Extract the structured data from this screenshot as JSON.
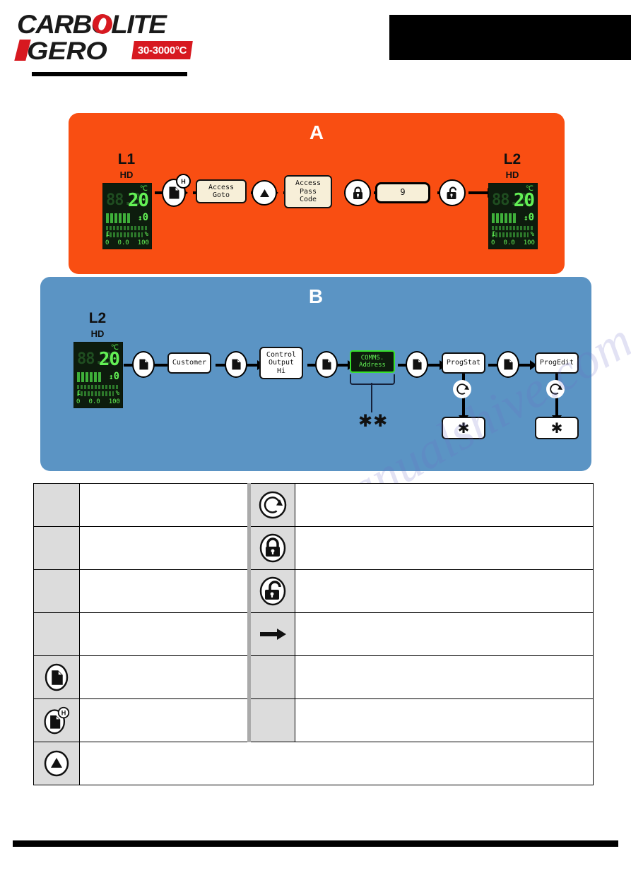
{
  "header": {
    "brand_line1": "CARBOLITE",
    "brand_line2": "GERO",
    "temp_range_badge": "30-3000°C",
    "brand_red": "#d71920",
    "brand_black": "#1a1a1a"
  },
  "panels": {
    "a": {
      "letter": "A",
      "background": "#f94e12",
      "display_start": {
        "level": "L1",
        "mode": "HD",
        "unit": "℃",
        "ghost": "88.8",
        "main": "20",
        "setpoint": "0",
        "tick_left": "I",
        "tick_right": "%",
        "scale_min": "0",
        "scale_mid": "0.0",
        "scale_max": "100"
      },
      "display_end": {
        "level": "L2",
        "mode": "HD",
        "unit": "℃",
        "ghost": "88.8",
        "main": "20",
        "setpoint": "0",
        "tick_left": "I",
        "tick_right": "%",
        "scale_min": "0",
        "scale_mid": "0.0",
        "scale_max": "100"
      },
      "steps": [
        {
          "kind": "icon",
          "icon": "page-hold-icon",
          "badge": "H"
        },
        {
          "kind": "box",
          "label": "Access\nGoto",
          "style": "cream"
        },
        {
          "kind": "icon",
          "icon": "up-arrow-icon"
        },
        {
          "kind": "box",
          "label": "Access\nPass\nCode",
          "style": "cream"
        },
        {
          "kind": "icon",
          "icon": "lock-closed-icon"
        },
        {
          "kind": "box",
          "label": "9",
          "style": "cream-thick"
        },
        {
          "kind": "icon",
          "icon": "lock-open-icon"
        }
      ]
    },
    "b": {
      "letter": "B",
      "background": "#5b94c4",
      "display_start": {
        "level": "L2",
        "mode": "HD",
        "unit": "℃",
        "ghost": "88.8",
        "main": "20",
        "setpoint": "0",
        "tick_left": "I",
        "tick_right": "%",
        "scale_min": "0",
        "scale_mid": "0.0",
        "scale_max": "100"
      },
      "steps": [
        {
          "kind": "icon",
          "icon": "page-icon"
        },
        {
          "kind": "box",
          "label": "Customer",
          "style": "white"
        },
        {
          "kind": "icon",
          "icon": "page-icon"
        },
        {
          "kind": "box",
          "label": "Control\nOutput\nHi",
          "style": "white"
        },
        {
          "kind": "icon",
          "icon": "page-icon"
        },
        {
          "kind": "box",
          "label": "COMMS.\nAddress",
          "style": "lcd"
        },
        {
          "kind": "icon",
          "icon": "page-icon"
        },
        {
          "kind": "box",
          "label": "ProgStat",
          "style": "white"
        },
        {
          "kind": "icon",
          "icon": "page-icon"
        },
        {
          "kind": "box",
          "label": "ProgEdit",
          "style": "white"
        }
      ],
      "footnote_marker": "✱✱",
      "branches": [
        {
          "from": "ProgStat",
          "icon": "scroll-icon",
          "target_label": "✱"
        },
        {
          "from": "ProgEdit",
          "icon": "scroll-icon",
          "target_label": "✱"
        }
      ]
    }
  },
  "legend_table": {
    "rows": [
      {
        "icon_left": "",
        "desc_left": "",
        "icon_right": "scroll-icon",
        "desc_right": ""
      },
      {
        "icon_left": "",
        "desc_left": "",
        "icon_right": "lock-closed-icon",
        "desc_right": ""
      },
      {
        "icon_left": "",
        "desc_left": "",
        "icon_right": "lock-open-icon",
        "desc_right": ""
      },
      {
        "icon_left": "",
        "desc_left": "",
        "icon_right": "right-arrow-icon",
        "desc_right": ""
      },
      {
        "icon_left": "page-icon",
        "desc_left": "",
        "icon_right": "",
        "desc_right": ""
      },
      {
        "icon_left": "page-hold-icon",
        "desc_left": "",
        "icon_right": "",
        "desc_right": ""
      },
      {
        "icon_left": "up-arrow-icon",
        "desc_left": "",
        "icon_right": "",
        "desc_right": ""
      }
    ]
  },
  "watermark": {
    "text1": "manualshive.com",
    "text2": "manualshive.com"
  }
}
